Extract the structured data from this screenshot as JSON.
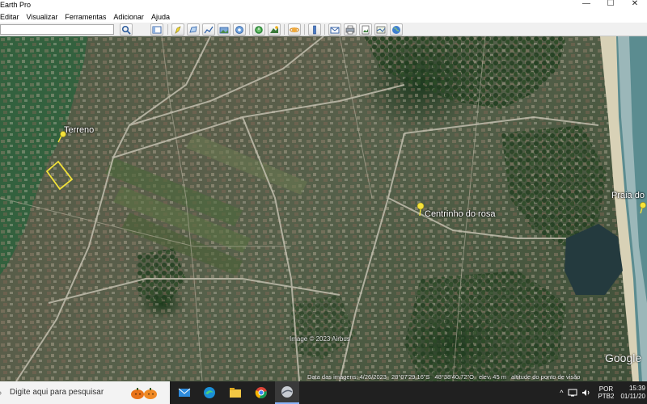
{
  "window": {
    "title": "Earth Pro",
    "buttons": {
      "minimize": "—",
      "maximize": "☐",
      "close": "✕"
    }
  },
  "menu": {
    "items": [
      "Editar",
      "Visualizar",
      "Ferramentas",
      "Adicionar",
      "Ajuda"
    ]
  },
  "toolbar": {
    "search_value": "",
    "icons": [
      "search-icon",
      "sidebar-toggle-icon",
      "placemark-icon",
      "polygon-icon",
      "path-icon",
      "image-overlay-icon",
      "record-tour-icon",
      "historical-imagery-icon",
      "sunlight-icon",
      "planets-icon",
      "ruler-icon",
      "email-icon",
      "print-icon",
      "save-image-icon",
      "maps-icon"
    ]
  },
  "map": {
    "labels": {
      "terreno": "Terreno",
      "centrinho": "Centrinho do rosa",
      "praia": "Praia do"
    },
    "copyright": "Image © 2023 Airbus",
    "google_logo": "Google",
    "status": {
      "date": "Data das imagens: 4/26/2023",
      "lat": "28°07'29.16\"S",
      "lon": "48°38'40.72\"O",
      "elevation": "elev. 45 m",
      "eye_alt": "altitude do ponto de visão"
    }
  },
  "taskbar": {
    "search_placeholder": "Digite aqui para pesquisar",
    "apps": [
      "mail-icon",
      "edge-icon",
      "file-explorer-icon",
      "chrome-icon",
      "google-earth-icon"
    ],
    "tray": {
      "lang_top": "POR",
      "lang_bottom": "PTB2",
      "time": "15:39",
      "date": "01/11/20"
    }
  },
  "colors": {
    "water": "#2e5a3a",
    "beach": "#d9d2b9",
    "ocean": "#5a8a8e",
    "pin": "#f5e33b"
  }
}
